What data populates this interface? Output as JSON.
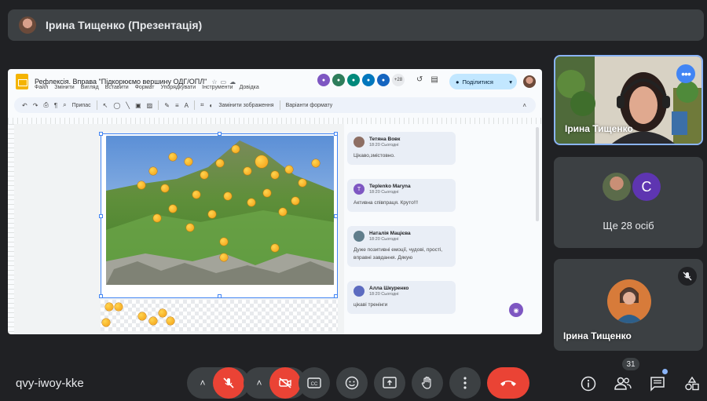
{
  "presenter_bar": {
    "title": "Ірина Тищенко (Презентація)"
  },
  "slides_app": {
    "doc_title": "Рефлексія. Вправа \"Підкорюємо вершину ОДГ/ОПЛ\"",
    "menu": [
      "Файл",
      "Змінити",
      "Вигляд",
      "Вставити",
      "Формат",
      "Упорядкувати",
      "Інструменти",
      "Довідка"
    ],
    "collaborators_more": "+28",
    "share_label": "Поділитися",
    "toolbar": {
      "snap_label": "Припас",
      "replace_image": "Замінити зображення",
      "format_options": "Варіанти формату"
    },
    "comments": [
      {
        "name": "Тетяна Вовк",
        "time": "18:20 Сьогодні",
        "text": "Цікаво,змістовно.",
        "avatar_color": "#8d6e63"
      },
      {
        "name": "Teplenko Maryna",
        "time": "18:20 Сьогодні",
        "text": "Активна співпраця. Круто!!!",
        "avatar_color": "#7e57c2",
        "initial": "T"
      },
      {
        "name": "Наталія Мацієва",
        "time": "18:20 Сьогодні",
        "text": "Дуже позитивні емоції, чудові, прості, вправні завдання. Дякую",
        "avatar_color": "#607d8b"
      },
      {
        "name": "Алла Шкуренко",
        "time": "18:20 Сьогодні",
        "text": "цікаві тренінги",
        "avatar_color": "#5c6bc0"
      }
    ]
  },
  "participants": {
    "speaker_tile": {
      "name": "Ірина Тищенко"
    },
    "others_tile": {
      "label": "Ще 28 осіб",
      "avatar_initial": "C"
    },
    "third_tile": {
      "name": "Ірина Тищенко"
    }
  },
  "bottom_bar": {
    "meeting_code": "qvy-iwoy-kke",
    "participants_count": "31"
  },
  "colors": {
    "end_call": "#ea4335",
    "muted": "#ea4335",
    "active_border": "#8ab4f8"
  }
}
